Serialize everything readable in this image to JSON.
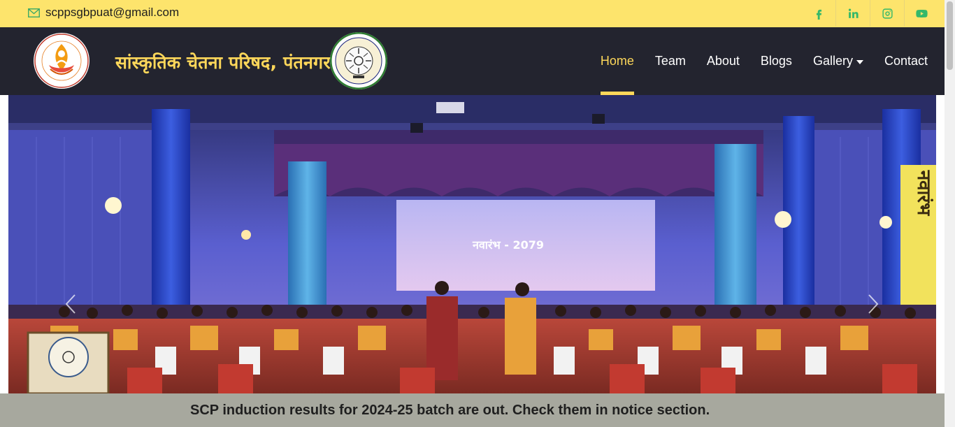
{
  "topbar": {
    "email": "scppsgbpuat@gmail.com",
    "social": [
      "facebook-icon",
      "linkedin-icon",
      "instagram-icon",
      "youtube-icon"
    ],
    "social_color": "#34b86a",
    "background": "#fde46c"
  },
  "navbar": {
    "brand": "सांस्कृतिक चेतना परिषद, पंतनगर",
    "logo_left_text": "सांस्कृतिक चेतना परिषद, पंतनगर",
    "logo_right_text": "गोविन्द बल्लभ पंत कृषि एवं प्रौद्योगिक विश्वविद्यालय",
    "items": [
      {
        "label": "Home",
        "active": true
      },
      {
        "label": "Team",
        "active": false
      },
      {
        "label": "About",
        "active": false
      },
      {
        "label": "Blogs",
        "active": false
      },
      {
        "label": "Gallery",
        "active": false,
        "dropdown": true
      },
      {
        "label": "Contact",
        "active": false
      }
    ],
    "accent": "#fdd75a",
    "background": "#23242f"
  },
  "carousel": {
    "screen_text": "नवारंभ - 2079",
    "banner_text": "नवारंभ",
    "prev": "carousel-prev",
    "next": "carousel-next"
  },
  "notice": {
    "text": "SCP induction results for 2024-25 batch are out. Check them in notice section.",
    "background": "#a7a89e"
  }
}
